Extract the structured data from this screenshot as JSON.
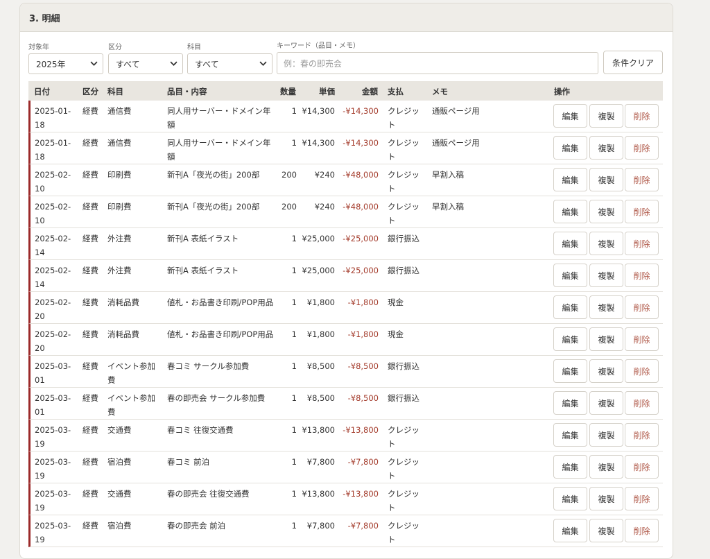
{
  "section": {
    "title": "3. 明細"
  },
  "filters": {
    "year_label": "対象年",
    "year_value": "2025年",
    "kubun_label": "区分",
    "kubun_value": "すべて",
    "kamoku_label": "科目",
    "kamoku_value": "すべて",
    "keyword_label": "キーワード（品目・メモ）",
    "keyword_placeholder": "例：春の即売会",
    "clear_button": "条件クリア"
  },
  "table": {
    "headers": {
      "date": "日付",
      "kubun": "区分",
      "kamoku": "科目",
      "item": "品目・内容",
      "qty": "数量",
      "price": "単価",
      "amount": "金額",
      "pay": "支払",
      "memo": "メモ",
      "ops": "操作"
    },
    "actions": {
      "edit": "編集",
      "copy": "複製",
      "delete": "削除"
    },
    "accent_color": "#9b2a2a",
    "negative_color": "#a33a2a",
    "rows": [
      {
        "date": "2025-01-18",
        "kubun": "経費",
        "kamoku": "通信費",
        "item": "同人用サーバー・ドメイン年額",
        "qty": "1",
        "price": "¥14,300",
        "amount": "-¥14,300",
        "pay": "クレジット",
        "memo": "通販ページ用"
      },
      {
        "date": "2025-01-18",
        "kubun": "経費",
        "kamoku": "通信費",
        "item": "同人用サーバー・ドメイン年額",
        "qty": "1",
        "price": "¥14,300",
        "amount": "-¥14,300",
        "pay": "クレジット",
        "memo": "通販ページ用"
      },
      {
        "date": "2025-02-10",
        "kubun": "経費",
        "kamoku": "印刷費",
        "item": "新刊A「夜光の街」200部",
        "qty": "200",
        "price": "¥240",
        "amount": "-¥48,000",
        "pay": "クレジット",
        "memo": "早割入稿"
      },
      {
        "date": "2025-02-10",
        "kubun": "経費",
        "kamoku": "印刷費",
        "item": "新刊A「夜光の街」200部",
        "qty": "200",
        "price": "¥240",
        "amount": "-¥48,000",
        "pay": "クレジット",
        "memo": "早割入稿"
      },
      {
        "date": "2025-02-14",
        "kubun": "経費",
        "kamoku": "外注費",
        "item": "新刊A 表紙イラスト",
        "qty": "1",
        "price": "¥25,000",
        "amount": "-¥25,000",
        "pay": "銀行振込",
        "memo": ""
      },
      {
        "date": "2025-02-14",
        "kubun": "経費",
        "kamoku": "外注費",
        "item": "新刊A 表紙イラスト",
        "qty": "1",
        "price": "¥25,000",
        "amount": "-¥25,000",
        "pay": "銀行振込",
        "memo": ""
      },
      {
        "date": "2025-02-20",
        "kubun": "経費",
        "kamoku": "消耗品費",
        "item": "値札・お品書き印刷/POP用品",
        "qty": "1",
        "price": "¥1,800",
        "amount": "-¥1,800",
        "pay": "現金",
        "memo": ""
      },
      {
        "date": "2025-02-20",
        "kubun": "経費",
        "kamoku": "消耗品費",
        "item": "値札・お品書き印刷/POP用品",
        "qty": "1",
        "price": "¥1,800",
        "amount": "-¥1,800",
        "pay": "現金",
        "memo": ""
      },
      {
        "date": "2025-03-01",
        "kubun": "経費",
        "kamoku": "イベント参加費",
        "item": "春コミ サークル参加費",
        "qty": "1",
        "price": "¥8,500",
        "amount": "-¥8,500",
        "pay": "銀行振込",
        "memo": ""
      },
      {
        "date": "2025-03-01",
        "kubun": "経費",
        "kamoku": "イベント参加費",
        "item": "春の即売会 サークル参加費",
        "qty": "1",
        "price": "¥8,500",
        "amount": "-¥8,500",
        "pay": "銀行振込",
        "memo": ""
      },
      {
        "date": "2025-03-19",
        "kubun": "経費",
        "kamoku": "交通費",
        "item": "春コミ 往復交通費",
        "qty": "1",
        "price": "¥13,800",
        "amount": "-¥13,800",
        "pay": "クレジット",
        "memo": ""
      },
      {
        "date": "2025-03-19",
        "kubun": "経費",
        "kamoku": "宿泊費",
        "item": "春コミ 前泊",
        "qty": "1",
        "price": "¥7,800",
        "amount": "-¥7,800",
        "pay": "クレジット",
        "memo": ""
      },
      {
        "date": "2025-03-19",
        "kubun": "経費",
        "kamoku": "交通費",
        "item": "春の即売会 往復交通費",
        "qty": "1",
        "price": "¥13,800",
        "amount": "-¥13,800",
        "pay": "クレジット",
        "memo": ""
      },
      {
        "date": "2025-03-19",
        "kubun": "経費",
        "kamoku": "宿泊費",
        "item": "春の即売会 前泊",
        "qty": "1",
        "price": "¥7,800",
        "amount": "-¥7,800",
        "pay": "クレジット",
        "memo": ""
      }
    ]
  }
}
